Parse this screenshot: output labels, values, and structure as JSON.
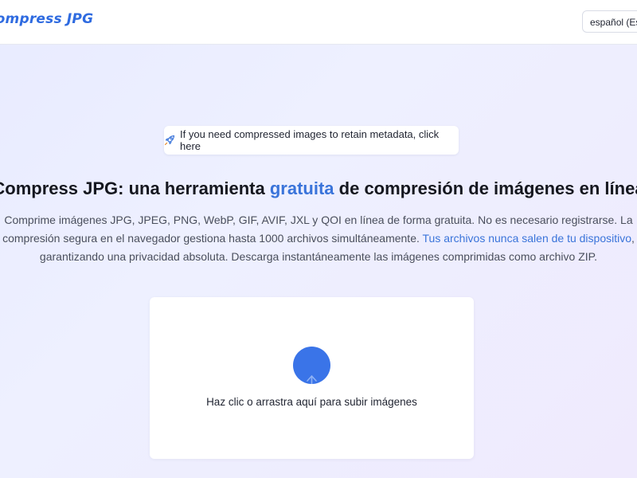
{
  "header": {
    "logo_text": "Compress JPG",
    "language_selector": "español (Español)"
  },
  "notice": {
    "icon": "rocket-icon",
    "text": "If you need compressed images to retain metadata, click here"
  },
  "hero": {
    "title_before": "Compress JPG: una herramienta ",
    "title_accent": "gratuita",
    "title_after": " de compresión de imágenes en línea",
    "description_part1": "Comprime imágenes JPG, JPEG, PNG, WebP, GIF, AVIF, JXL y QOI en línea de forma gratuita. No es necesario registrarse. La compresión segura en el navegador gestiona hasta 1000 archivos simultáneamente. ",
    "description_link": "Tus archivos nunca salen de tu dispositivo",
    "description_part2": ", garantizando una privacidad absoluta. Descarga instantáneamente las imágenes comprimidas como archivo ZIP."
  },
  "upload": {
    "icon": "upload-icon",
    "prompt": "Haz clic o arrastra aquí para subir imágenes"
  },
  "colors": {
    "accent": "#3a74da",
    "upload_circle": "#3a74e8",
    "background": "#eceeff"
  }
}
